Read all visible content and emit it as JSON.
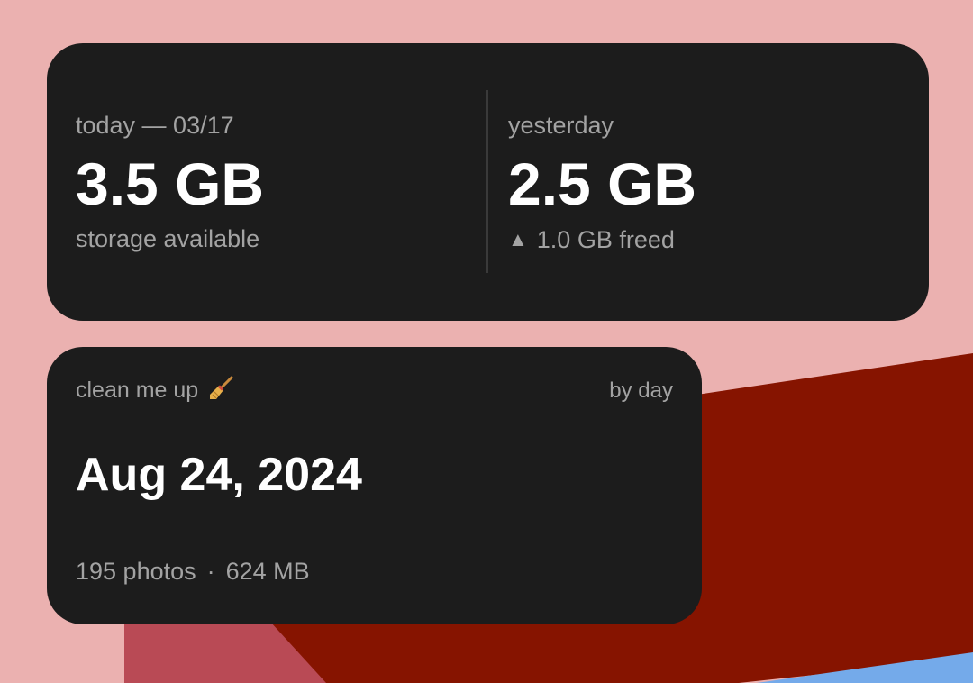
{
  "colors": {
    "background": "#ebb1b0",
    "widget": "#1c1c1c",
    "muted_text": "#a3a3a3",
    "accent_dark_red": "#861400",
    "accent_rose": "#b94a55",
    "accent_blue": "#74aaea"
  },
  "storage": {
    "today_label": "today — 03/17",
    "today_value": "3.5 GB",
    "today_sub": "storage available",
    "yesterday_label": "yesterday",
    "yesterday_value": "2.5 GB",
    "freed_icon": "up-triangle-icon",
    "freed_text": "1.0 GB freed"
  },
  "cleanup": {
    "title": "clean me up",
    "title_icon": "broom-icon",
    "mode_label": "by day",
    "date": "Aug 24, 2024",
    "photos": "195 photos",
    "separator": "·",
    "size": "624 MB"
  }
}
